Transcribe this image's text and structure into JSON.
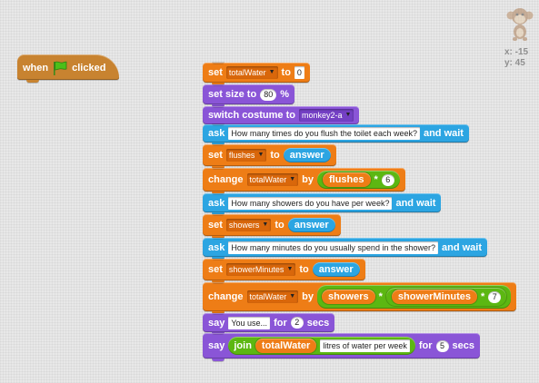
{
  "hat": {
    "when": "when",
    "clicked": "clicked"
  },
  "blocks": {
    "b1": {
      "set": "set",
      "var": "totalWater",
      "to": "to",
      "value": "0"
    },
    "b2": {
      "label": "set size to",
      "value": "80",
      "unit": "%"
    },
    "b3": {
      "label": "switch costume to",
      "costume": "monkey2-a"
    },
    "b4": {
      "ask": "ask",
      "question": "How many times do you flush the toilet each week?",
      "and_wait": "and wait"
    },
    "b5": {
      "set": "set",
      "var": "flushes",
      "to": "to",
      "reporter": "answer"
    },
    "b6": {
      "change": "change",
      "var": "totalWater",
      "by": "by",
      "reporter": "flushes",
      "op": "*",
      "value": "6"
    },
    "b7": {
      "ask": "ask",
      "question": "How many showers do you have per week?",
      "and_wait": "and wait"
    },
    "b8": {
      "set": "set",
      "var": "showers",
      "to": "to",
      "reporter": "answer"
    },
    "b9": {
      "ask": "ask",
      "question": "How many minutes do you usually spend in the shower?",
      "and_wait": "and wait"
    },
    "b10": {
      "set": "set",
      "var": "showerMinutes",
      "to": "to",
      "reporter": "answer"
    },
    "b11": {
      "change": "change",
      "var": "totalWater",
      "by": "by",
      "rep1": "showers",
      "op1": "*",
      "rep2": "showerMinutes",
      "op2": "*",
      "value": "7"
    },
    "b12": {
      "say": "say",
      "text": "You use...",
      "for": "for",
      "secs_value": "2",
      "secs": "secs"
    },
    "b13": {
      "say": "say",
      "join": "join",
      "reporter": "totalWater",
      "text": "litres of water per week",
      "for": "for",
      "secs_value": "5",
      "secs": "secs"
    }
  },
  "sprite": {
    "x_label": "x: -15",
    "y_label": "y: 45"
  },
  "colors": {
    "data": "#ee7d16",
    "looks": "#8a55d7",
    "sensing": "#2ca5e2",
    "events": "#c88330",
    "operators": "#5cb712"
  },
  "icons": {
    "green_flag": "green-flag-icon",
    "dropdown": "dropdown-arrow-icon",
    "sprite": "monkey-sprite-icon"
  }
}
